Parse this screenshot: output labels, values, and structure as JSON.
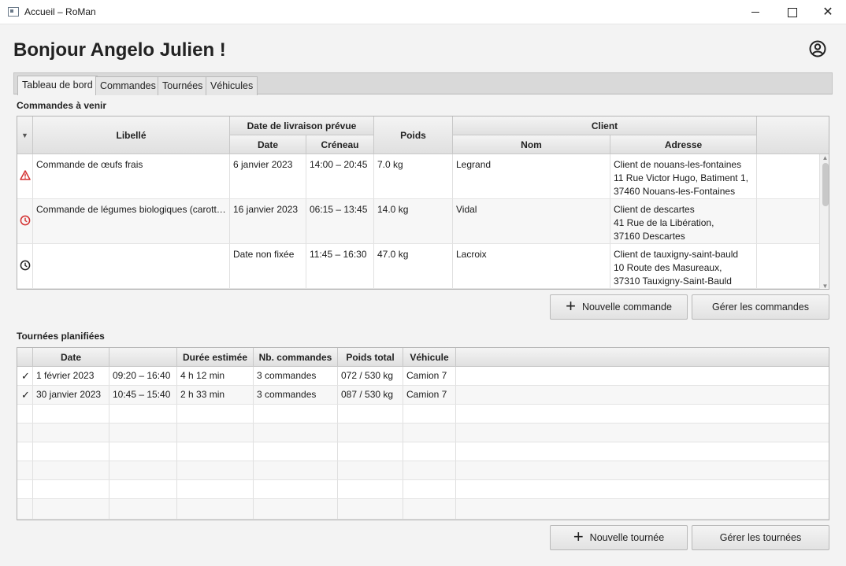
{
  "window": {
    "title": "Accueil – RoMan",
    "close_glyph": "✕"
  },
  "greeting": "Bonjour Angelo Julien !",
  "tabs": [
    "Tableau de bord",
    "Commandes",
    "Tournées",
    "Véhicules"
  ],
  "orders": {
    "title": "Commandes à venir",
    "sort_glyph": "▼",
    "headers": {
      "libelle": "Libellé",
      "delivery_group": "Date de livraison prévue",
      "date": "Date",
      "slot": "Créneau",
      "weight": "Poids",
      "client_group": "Client",
      "name": "Nom",
      "address": "Adresse"
    },
    "rows": [
      {
        "status_icon": "warning-icon",
        "libelle": "Commande de œufs frais",
        "date": "6 janvier 2023",
        "slot": "14:00 – 20:45",
        "weight": "7.0 kg",
        "name": "Legrand",
        "address": "Client de nouans-les-fontaines\n11 Rue Victor Hugo, Batiment 1,\n37460 Nouans-les-Fontaines"
      },
      {
        "status_icon": "clock-alert-icon",
        "libelle": "Commande de légumes biologiques (carott…",
        "date": "16 janvier 2023",
        "slot": "06:15 – 13:45",
        "weight": "14.0 kg",
        "name": "Vidal",
        "address": "Client de descartes\n41 Rue de la Libération,\n37160 Descartes"
      },
      {
        "status_icon": "clock-icon",
        "libelle": "",
        "date": "Date non fixée",
        "slot": "11:45 – 16:30",
        "weight": "47.0 kg",
        "name": "Lacroix",
        "address": "Client de tauxigny-saint-bauld\n10 Route des Masureaux,\n37310 Tauxigny-Saint-Bauld"
      }
    ],
    "buttons": {
      "new": "Nouvelle commande",
      "manage": "Gérer les commandes"
    }
  },
  "tours": {
    "title": "Tournées planifiées",
    "headers": {
      "date": "Date",
      "time": "",
      "duration": "Durée estimée",
      "orders": "Nb. commandes",
      "weight": "Poids total",
      "vehicle": "Véhicule"
    },
    "rows": [
      {
        "check": "✓",
        "date": "1 février 2023",
        "time": "09:20 – 16:40",
        "duration": "4 h 12 min",
        "orders": "3 commandes",
        "weight": "072 / 530 kg",
        "vehicle": "Camion 7"
      },
      {
        "check": "✓",
        "date": "30 janvier 2023",
        "time": "10:45 – 15:40",
        "duration": "2 h 33 min",
        "orders": "3 commandes",
        "weight": "087 / 530 kg",
        "vehicle": "Camion 7"
      }
    ],
    "buttons": {
      "new": "Nouvelle tournée",
      "manage": "Gérer les tournées"
    }
  },
  "colors": {
    "warning": "#d32f2f",
    "clock_alert": "#d32f2f",
    "clock": "#222222"
  }
}
